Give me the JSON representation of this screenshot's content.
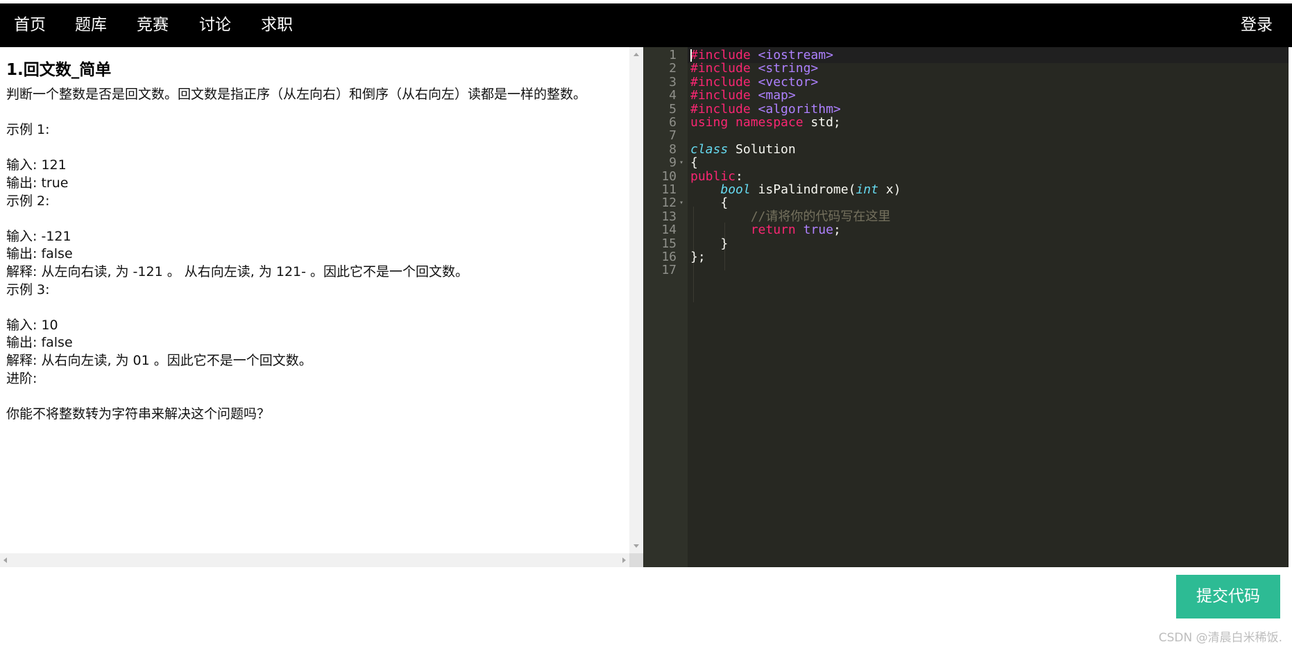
{
  "nav": {
    "items": [
      {
        "label": "首页"
      },
      {
        "label": "题库"
      },
      {
        "label": "竞赛"
      },
      {
        "label": "讨论"
      },
      {
        "label": "求职"
      }
    ],
    "login": "登录"
  },
  "problem": {
    "title": "1.回文数_简单",
    "description": "判断一个整数是否是回文数。回文数是指正序（从左向右）和倒序（从右向左）读都是一样的整数。\n\n示例 1:\n\n输入: 121\n输出: true\n示例 2:\n\n输入: -121\n输出: false\n解释: 从左向右读, 为 -121 。 从右向左读, 为 121- 。因此它不是一个回文数。\n示例 3:\n\n输入: 10\n输出: false\n解释: 从右向左读, 为 01 。因此它不是一个回文数。\n进阶:\n\n你能不将整数转为字符串来解决这个问题吗？"
  },
  "editor": {
    "line_numbers": [
      "1",
      "2",
      "3",
      "4",
      "5",
      "6",
      "7",
      "8",
      "9",
      "10",
      "11",
      "12",
      "13",
      "14",
      "15",
      "16",
      "17"
    ],
    "lines": [
      "#include <iostream>",
      "#include <string>",
      "#include <vector>",
      "#include <map>",
      "#include <algorithm>",
      "using namespace std;",
      "",
      "class Solution",
      "{",
      "public:",
      "    bool isPalindrome(int x)",
      "    {",
      "        //请将你的代码写在这里",
      "        return true;",
      "    }",
      "};",
      ""
    ],
    "theme": {
      "background": "#272822",
      "gutter": "#2f3129",
      "keyword": "#f92672",
      "string": "#ae81ff",
      "type": "#66d9ef",
      "comment": "#75715e"
    }
  },
  "submit_label": "提交代码",
  "watermark": "CSDN @清晨白米稀饭."
}
